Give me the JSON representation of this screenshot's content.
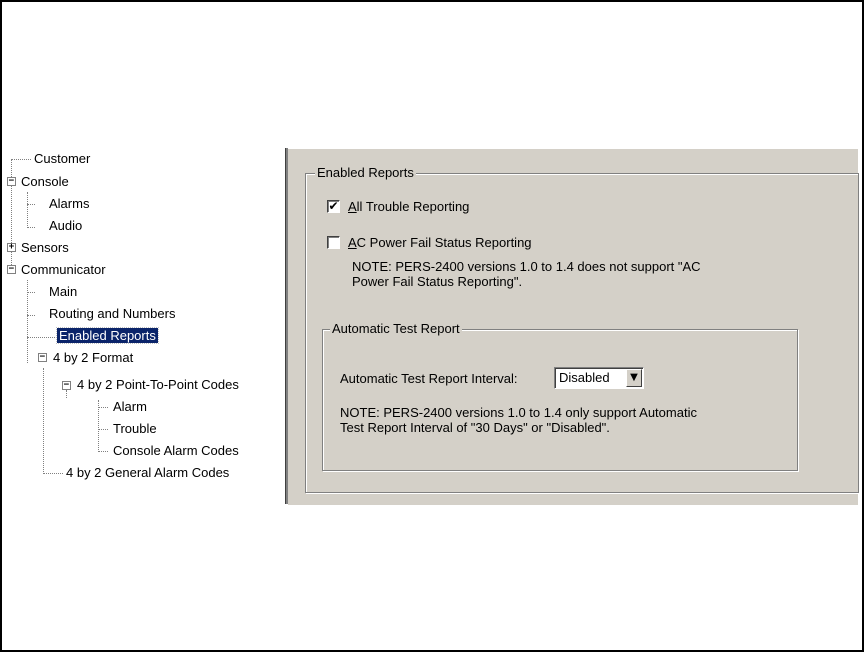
{
  "tree": {
    "items": [
      {
        "label": "Customer"
      },
      {
        "label": "Console",
        "expander": "−"
      },
      {
        "label": "Alarms"
      },
      {
        "label": "Audio"
      },
      {
        "label": "Sensors",
        "expander": "+"
      },
      {
        "label": "Communicator",
        "expander": "−"
      },
      {
        "label": "Main"
      },
      {
        "label": "Routing and Numbers"
      },
      {
        "label": "Enabled Reports",
        "selected": true
      },
      {
        "label": "4 by 2 Format",
        "expander": "−"
      },
      {
        "label": "4 by 2 Point-To-Point Codes",
        "expander": "−"
      },
      {
        "label": "Alarm"
      },
      {
        "label": "Trouble"
      },
      {
        "label": "Console Alarm Codes"
      },
      {
        "label": "4 by 2 General Alarm Codes"
      }
    ]
  },
  "panel": {
    "group_title": "Enabled Reports",
    "all_trouble": {
      "accel": "A",
      "rest": "ll Trouble Reporting",
      "checked": true,
      "check_glyph": "✔"
    },
    "ac_power": {
      "accel": "A",
      "rest": "C Power Fail Status Reporting",
      "checked": false
    },
    "note1_line1": "NOTE: PERS-2400 versions 1.0 to 1.4 does not support \"AC",
    "note1_line2": "Power Fail Status Reporting\".",
    "test_group_title": "Automatic Test Report",
    "interval_label": "Automatic Test Report Interval:",
    "interval_value": "Disabled",
    "dropdown_glyph": "▼",
    "note2_line1": "NOTE: PERS-2400 versions 1.0 to 1.4 only support Automatic",
    "note2_line2": "Test Report Interval of \"30 Days\" or \"Disabled\"."
  },
  "colors": {
    "panel_bg": "#d4d0c8",
    "selection_bg": "#0a246a",
    "selection_fg": "#ffffff"
  }
}
